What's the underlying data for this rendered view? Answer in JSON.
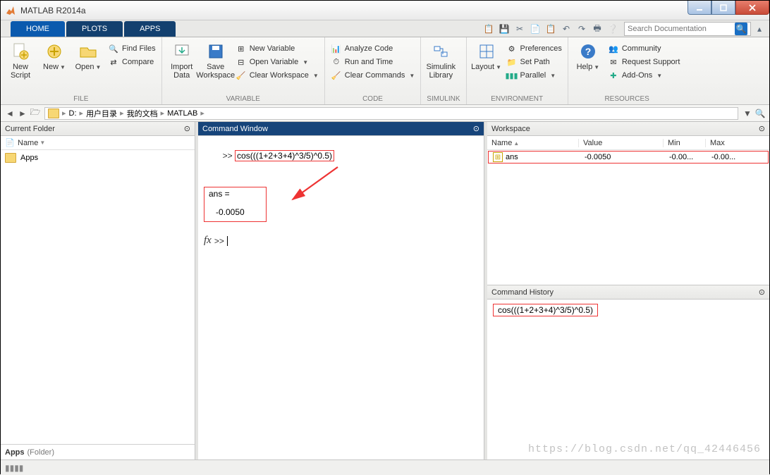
{
  "window": {
    "title": "MATLAB R2014a"
  },
  "tabs": {
    "home": "HOME",
    "plots": "PLOTS",
    "apps": "APPS"
  },
  "search": {
    "placeholder": "Search Documentation"
  },
  "ribbon": {
    "file": {
      "new_script": "New\nScript",
      "new": "New",
      "open": "Open",
      "find_files": "Find Files",
      "compare": "Compare",
      "label": "FILE"
    },
    "variable": {
      "import": "Import\nData",
      "save_ws": "Save\nWorkspace",
      "new_var": "New Variable",
      "open_var": "Open Variable",
      "clear_ws": "Clear Workspace",
      "label": "VARIABLE"
    },
    "code": {
      "analyze": "Analyze Code",
      "run_time": "Run and Time",
      "clear_cmds": "Clear Commands",
      "label": "CODE"
    },
    "simulink": {
      "lib": "Simulink\nLibrary",
      "label": "SIMULINK"
    },
    "environment": {
      "layout": "Layout",
      "preferences": "Preferences",
      "set_path": "Set Path",
      "parallel": "Parallel",
      "label": "ENVIRONMENT"
    },
    "resources": {
      "help": "Help",
      "community": "Community",
      "request": "Request Support",
      "addons": "Add-Ons",
      "label": "RESOURCES"
    }
  },
  "breadcrumb": {
    "d": "D:",
    "b1": "用户目录",
    "b2": "我的文档",
    "b3": "MATLAB"
  },
  "current_folder": {
    "title": "Current Folder",
    "col_name": "Name",
    "item1": "Apps",
    "footer_label": "Apps",
    "footer_type": "(Folder)"
  },
  "command_window": {
    "title": "Command Window",
    "prompt": ">> ",
    "cmd": "cos(((1+2+3+4)^3/5)^0.5)",
    "ans_label": "ans =",
    "ans_value": "   -0.0050",
    "prompt2": ">> "
  },
  "workspace": {
    "title": "Workspace",
    "cols": {
      "name": "Name",
      "value": "Value",
      "min": "Min",
      "max": "Max"
    },
    "row": {
      "name": "ans",
      "value": "-0.0050",
      "min": "-0.00...",
      "max": "-0.00..."
    }
  },
  "command_history": {
    "title": "Command History",
    "item": "cos(((1+2+3+4)^3/5)^0.5)"
  },
  "watermark": "https://blog.csdn.net/qq_42446456"
}
